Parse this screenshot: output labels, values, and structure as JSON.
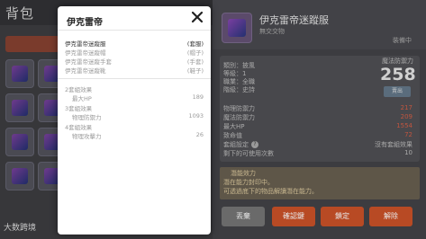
{
  "background": {
    "title": "背包",
    "detail": {
      "item_name": "伊克雷帝迷蹤服",
      "item_sub": "無交交物",
      "equipped_label": "裝備中",
      "stats_left": [
        "類別：披風",
        "等級：1",
        "職業：全職",
        "階級：史詩"
      ],
      "stat_block_label": "魔法防禦力",
      "stat_block_value": "258",
      "sell_label": "賣出",
      "stats": [
        {
          "label": "物理防禦力",
          "value": "217"
        },
        {
          "label": "魔法防禦力",
          "value": "209"
        },
        {
          "label": "最大HP",
          "value": "1554"
        },
        {
          "label": "致命值",
          "value": "72"
        },
        {
          "label": "套組設定",
          "value": "沒有套組效果"
        },
        {
          "label": "剩下的可使用次數",
          "value": "10"
        }
      ],
      "note_title": "潛能效力",
      "note_lines": [
        "潛在能力封印中。",
        "可透過底下的物品解讀潛在能力。"
      ],
      "actions": [
        "丟棄",
        "確認鍵",
        "鎖定",
        "解除"
      ]
    }
  },
  "watermark": "大数跨境",
  "modal": {
    "title": "伊克雷帝",
    "close_icon": "close-icon",
    "set_items": [
      {
        "name": "伊克雷帝迷蹤服",
        "slot": "(套服)",
        "active": true
      },
      {
        "name": "伊克雷帝迷蹤帽",
        "slot": "(帽子)",
        "active": false
      },
      {
        "name": "伊克雷帝迷蹤手套",
        "slot": "(手套)",
        "active": false
      },
      {
        "name": "伊克雷帝迷蹤靴",
        "slot": "(鞋子)",
        "active": false
      }
    ],
    "bonuses": [
      {
        "heading": "2套組效果",
        "stat": "最大HP",
        "value": "189"
      },
      {
        "heading": "3套組效果",
        "stat": "物理防禦力",
        "value": "1093"
      },
      {
        "heading": "4套組效果",
        "stat": "物理攻擊力",
        "value": "26"
      }
    ]
  }
}
